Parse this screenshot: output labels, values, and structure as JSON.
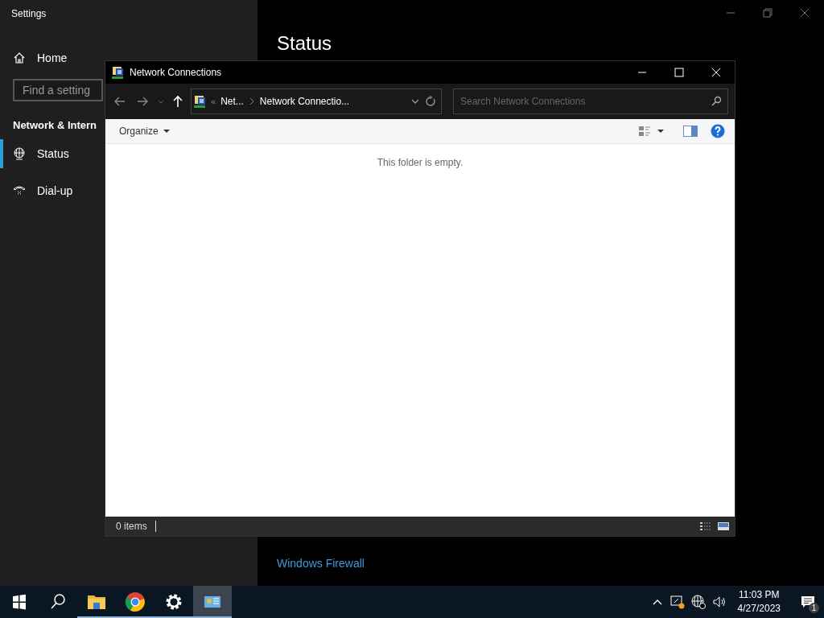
{
  "settings": {
    "title": "Settings",
    "home": "Home",
    "search": {
      "placeholder": "Find a setting"
    },
    "section": "Network & Intern",
    "nav": [
      {
        "label": "Status",
        "kind": "globe",
        "selected": true
      },
      {
        "label": "Dial-up",
        "kind": "phone",
        "selected": false
      }
    ],
    "page_heading": "Status",
    "link": "Windows Firewall"
  },
  "explorer": {
    "title": "Network Connections",
    "breadcrumb_prefix": "«",
    "breadcrumb": [
      "Net...",
      "Network Connectio..."
    ],
    "search": {
      "placeholder": "Search Network Connections"
    },
    "organize": "Organize",
    "empty_message": "This folder is empty.",
    "status": "0 items"
  },
  "taskbar": {
    "apps": [
      {
        "kind": "explorer",
        "running": true,
        "active": false
      },
      {
        "kind": "chrome",
        "running": true,
        "active": false
      },
      {
        "kind": "settings",
        "running": true,
        "active": false
      },
      {
        "kind": "network",
        "running": true,
        "active": true
      }
    ],
    "time": "11:03 PM",
    "date": "4/27/2023",
    "notifications": "1"
  }
}
